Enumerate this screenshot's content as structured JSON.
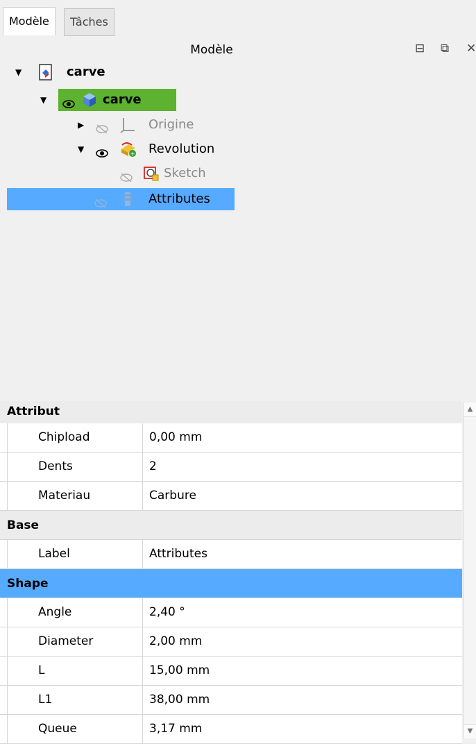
{
  "tabs": [
    "Modèle",
    "Tâches"
  ],
  "header": {
    "title": "Modèle"
  },
  "tree": [
    {
      "label": "carve",
      "bold": true,
      "expanded": true
    },
    {
      "label": "carve",
      "bold": true,
      "expanded": true,
      "highlight": "#5db22f"
    },
    {
      "label": "Origine",
      "expanded": false,
      "hidden": true
    },
    {
      "label": "Revolution",
      "expanded": true
    },
    {
      "label": "Sketch",
      "hidden": true
    },
    {
      "label": "Attributes",
      "selected": true,
      "highlight": "#56aaff"
    }
  ],
  "properties": {
    "groups": [
      {
        "name": "Attribut",
        "rows": [
          {
            "name": "Chipload",
            "value": "0,00 mm"
          },
          {
            "name": "Dents",
            "value": "2"
          },
          {
            "name": "Materiau",
            "value": "Carbure"
          }
        ]
      },
      {
        "name": "Base",
        "rows": [
          {
            "name": "Label",
            "value": "Attributes"
          }
        ]
      },
      {
        "name": "Shape",
        "selected": true,
        "rows": [
          {
            "name": "Angle",
            "value": "2,40 °"
          },
          {
            "name": "Diameter",
            "value": "2,00 mm"
          },
          {
            "name": "L",
            "value": "15,00 mm"
          },
          {
            "name": "L1",
            "value": "38,00 mm"
          },
          {
            "name": "Queue",
            "value": "3,17 mm"
          }
        ]
      }
    ]
  }
}
